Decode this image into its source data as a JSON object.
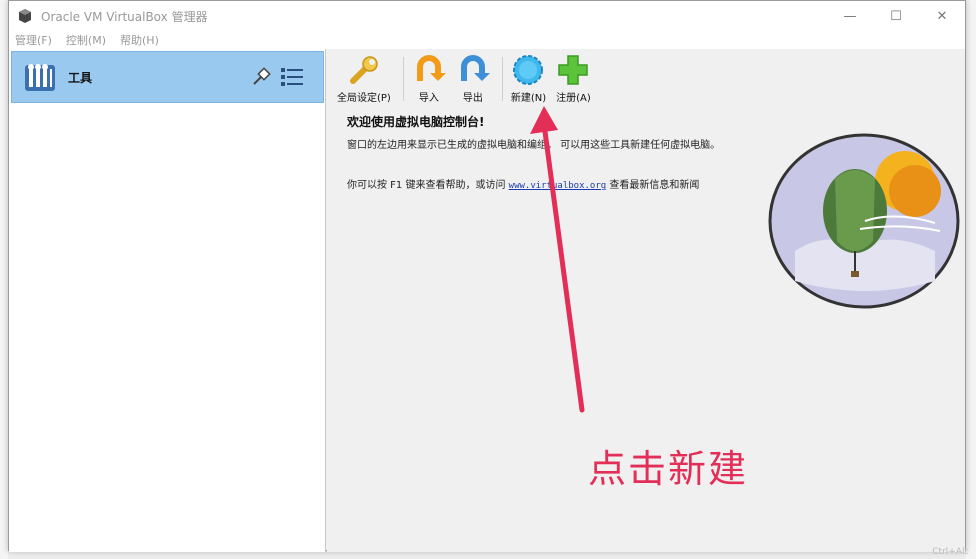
{
  "window": {
    "title": "Oracle VM VirtualBox 管理器",
    "controls": {
      "minimize": "—",
      "maximize": "☐",
      "close": "✕"
    }
  },
  "menu": [
    "管理(F)",
    "控制(M)",
    "帮助(H)"
  ],
  "sidebar": {
    "tools_label": "工具",
    "tools_icon": "tools-icon",
    "pin_icon": "pin-icon",
    "menu_icon": "list-menu-icon",
    "selected_color": "#99c9ef"
  },
  "toolbar": {
    "buttons": [
      {
        "label": "全局设定(P)",
        "icon": "wrench-settings-icon"
      },
      {
        "label": "导入",
        "icon": "import-icon"
      },
      {
        "label": "导出",
        "icon": "export-icon"
      },
      {
        "label": "新建(N)",
        "icon": "new-gear-icon"
      },
      {
        "label": "注册(A)",
        "icon": "add-plus-icon"
      }
    ]
  },
  "welcome": {
    "title": "欢迎使用虚拟电脑控制台!",
    "paragraph1": "窗口的左边用来显示已生成的虚拟电脑和编组。 可以用这些工具新建任何虚拟电脑。",
    "paragraph2_pre": "你可以按 F1 键来查看帮助，或访问 ",
    "link": "www.virtualbox.org",
    "paragraph2_post": " 查看最新信息和新闻"
  },
  "annotation": {
    "text": "点击新建",
    "color": "#e32e58"
  },
  "watermark": "Ctrl+Alt"
}
